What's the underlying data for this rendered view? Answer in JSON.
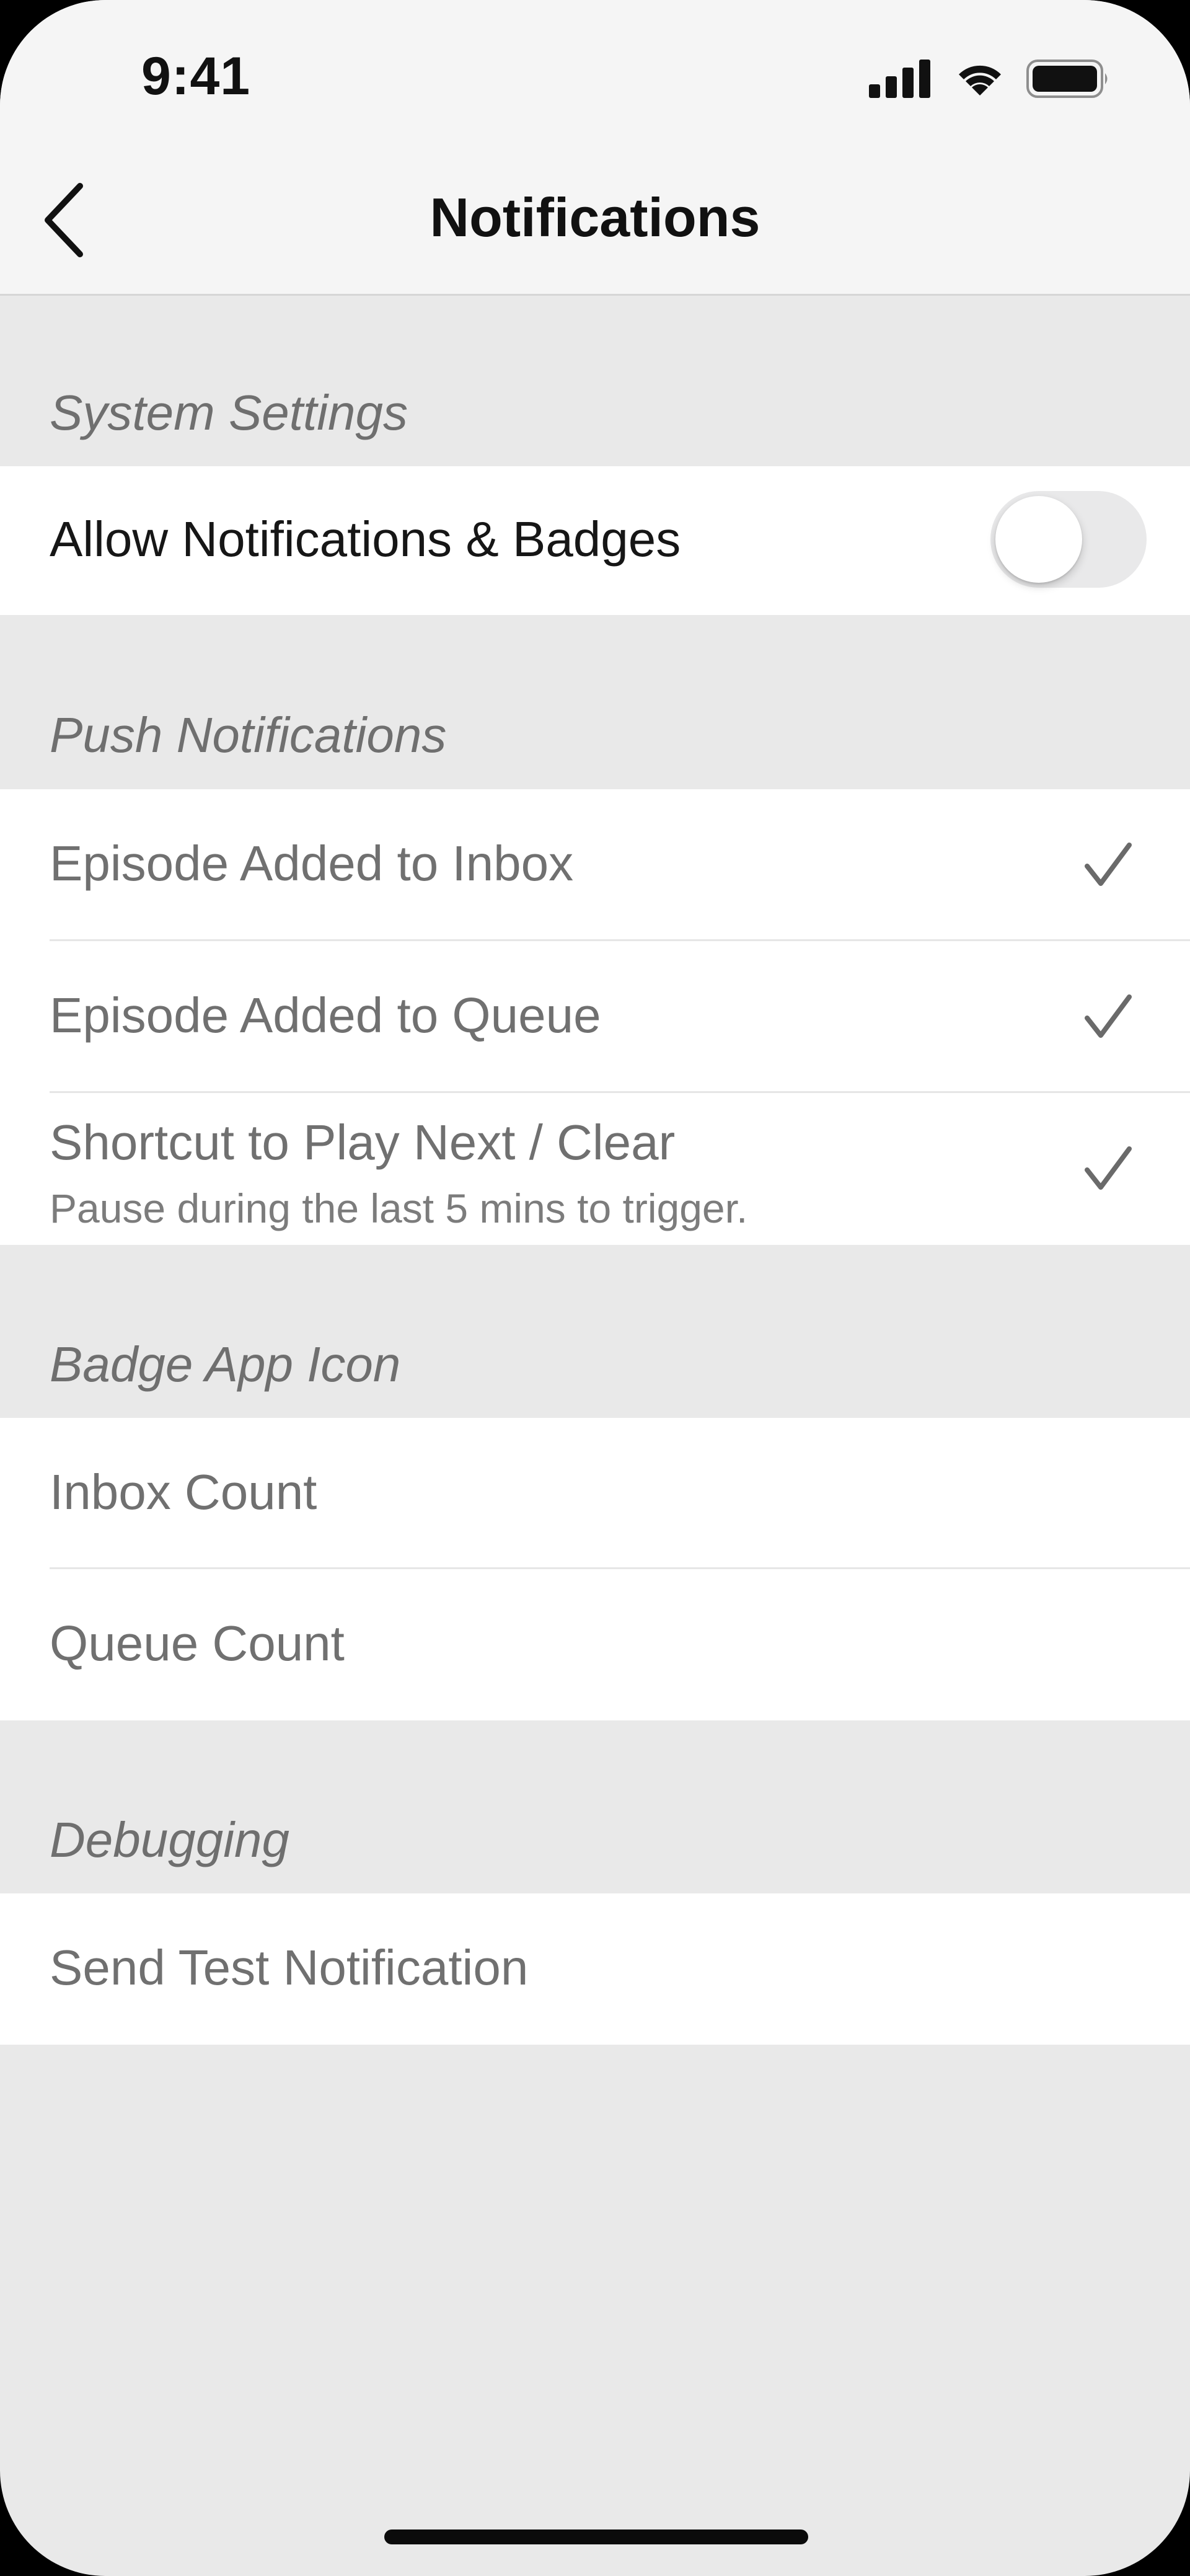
{
  "status_bar": {
    "time": "9:41",
    "signal_icon": "cellular-signal-icon",
    "wifi_icon": "wifi-icon",
    "battery_icon": "battery-icon"
  },
  "nav": {
    "title": "Notifications",
    "back_icon": "chevron-left-icon"
  },
  "sections": {
    "system": {
      "header": "System Settings",
      "allow_label": "Allow Notifications & Badges",
      "allow_enabled": false
    },
    "push": {
      "header": "Push Notifications",
      "items": [
        {
          "label": "Episode Added to Inbox",
          "checked": true
        },
        {
          "label": "Episode Added to Queue",
          "checked": true
        },
        {
          "label": "Shortcut to Play Next / Clear",
          "sublabel": "Pause during the last 5 mins to trigger.",
          "checked": true
        }
      ]
    },
    "badge": {
      "header": "Badge App Icon",
      "items": [
        {
          "label": "Inbox Count"
        },
        {
          "label": "Queue Count"
        }
      ]
    },
    "debugging": {
      "header": "Debugging",
      "items": [
        {
          "label": "Send Test Notification"
        }
      ]
    }
  },
  "colors": {
    "background": "#e9e9e9",
    "header_bg": "#f5f5f5",
    "row_bg": "#ffffff",
    "muted_text": "#707070",
    "primary_text": "#161616",
    "checkmark": "#6a6a6a"
  }
}
